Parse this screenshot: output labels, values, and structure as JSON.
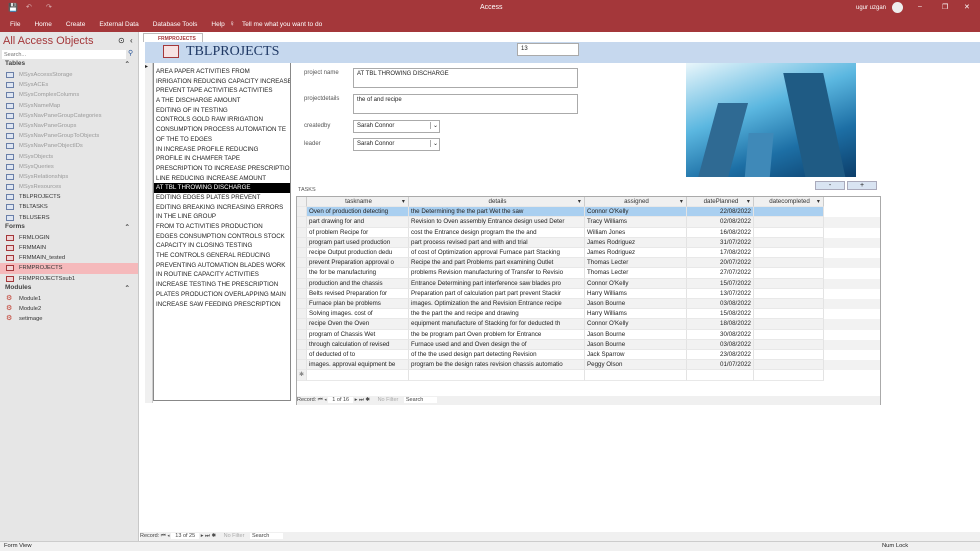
{
  "app": {
    "title": "Access",
    "user": "ugur uzgan",
    "menu": [
      "File",
      "Home",
      "Create",
      "External Data",
      "Database Tools",
      "Help"
    ],
    "tell_me": "Tell me what you want to do"
  },
  "nav": {
    "title": "All Access Objects",
    "search_placeholder": "Search...",
    "sections": [
      {
        "label": "Tables",
        "kind": "t",
        "items": [
          {
            "label": "MSysAccessStorage",
            "sys": true
          },
          {
            "label": "MSysACEs",
            "sys": true
          },
          {
            "label": "MSysComplexColumns",
            "sys": true
          },
          {
            "label": "MSysNameMap",
            "sys": true
          },
          {
            "label": "MSysNavPaneGroupCategories",
            "sys": true
          },
          {
            "label": "MSysNavPaneGroups",
            "sys": true
          },
          {
            "label": "MSysNavPaneGroupToObjects",
            "sys": true
          },
          {
            "label": "MSysNavPaneObjectIDs",
            "sys": true
          },
          {
            "label": "MSysObjects",
            "sys": true
          },
          {
            "label": "MSysQueries",
            "sys": true
          },
          {
            "label": "MSysRelationships",
            "sys": true
          },
          {
            "label": "MSysResources",
            "sys": true
          },
          {
            "label": "TBLPROJECTS"
          },
          {
            "label": "TBLTASKS"
          },
          {
            "label": "TBLUSERS"
          }
        ]
      },
      {
        "label": "Forms",
        "kind": "f",
        "items": [
          {
            "label": "FRMLOGIN"
          },
          {
            "label": "FRMMAIN"
          },
          {
            "label": "FRMMAIN_tested"
          },
          {
            "label": "FRMPROJECTS",
            "selected": true
          },
          {
            "label": "FRMPROJECTSsub1"
          }
        ]
      },
      {
        "label": "Modules",
        "kind": "m",
        "items": [
          {
            "label": "Module1"
          },
          {
            "label": "Module2"
          },
          {
            "label": "setimage"
          }
        ]
      }
    ]
  },
  "form": {
    "tab": "FRMPROJECTS",
    "title": "TBLPROJECTS",
    "id_value": "13",
    "projects": [
      "AREA PAPER ACTIVITIES FROM",
      "IRRIGATION REDUCING CAPACITY INCREASE",
      "PREVENT TAPE ACTIVITIES ACTIVITIES",
      "A THE DISCHARGE AMOUNT",
      "EDITING OF IN TESTING",
      "CONTROLS GOLD RAW IRRIGATION",
      "CONSUMPTION PROCESS AUTOMATION TE",
      "OF THE TO EDGES",
      "IN INCREASE PROFILE REDUCING",
      "PROFILE IN CHAMFER TAPE",
      "PRESCRIPTION TO INCREASE PRESCRIPTION",
      "LINE REDUCING INCREASE AMOUNT",
      "AT TBL THROWING DISCHARGE",
      "EDITING EDGES PLATES PREVENT",
      "EDITING BREAKING INCREASING ERRORS",
      "IN THE LINE GROUP",
      "FROM TO ACTIVITIES PRODUCTION",
      "EDGES CONSUMPTION CONTROLS STOCK",
      "CAPACITY IN CLOSING TESTING",
      "THE CONTROLS GENERAL REDUCING",
      "PREVENTING AUTOMATION BLADES WORK",
      "IN ROUTINE CAPACITY ACTIVITIES",
      "INCREASE TESTING THE PRESCRIPTION",
      "PLATES PRODUCTION OVERLAPPING MAIN",
      "INCREASE SAW FEEDING PRESCRIPTION"
    ],
    "selected_project_index": 12,
    "fields": {
      "project_name_label": "project name",
      "project_name": "AT TBL THROWING DISCHARGE",
      "projectdetails_label": "projectdetails",
      "projectdetails": "the of and recipe",
      "createdby_label": "createdby",
      "createdby": "Sarah Connor",
      "leader_label": "leader",
      "leader": "Sarah Connor"
    },
    "tasks_label": "TASKS",
    "minus": "-",
    "plus": "+",
    "record_nav": {
      "label": "Record:",
      "position": "13 of 25",
      "filter": "No Filter",
      "search": "Search"
    }
  },
  "tasks": {
    "columns": [
      "taskname",
      "details",
      "assigned",
      "datePlanned",
      "datecompleted"
    ],
    "rows": [
      [
        "Oven of production detecting",
        "the Determining the the part Wet the saw",
        "Connor O'Kelly",
        "22/08/2022",
        ""
      ],
      [
        "part drawing for and",
        "Revision to Oven assembly Entrance design used Deter",
        "Tracy Williams",
        "02/08/2022",
        ""
      ],
      [
        "of problem Recipe for",
        "cost the Entrance design program the the and",
        "William Jones",
        "16/08/2022",
        ""
      ],
      [
        "program part used production",
        "part process revised part and with and trial",
        "James Rodriguez",
        "31/07/2022",
        ""
      ],
      [
        "recipe Output production dedu",
        "of cost of Optimization approval Furnace part Stacking",
        "James Rodriguez",
        "17/08/2022",
        ""
      ],
      [
        "prevent Preparation approval o",
        "Recipe the and part Problems part examining Outlet",
        "Thomas Lecter",
        "20/07/2022",
        ""
      ],
      [
        "the for be manufacturing",
        "problems Revision manufacturing of Transfer to Revisio",
        "Thomas Lecter",
        "27/07/2022",
        ""
      ],
      [
        "production and the chassis",
        "Entrance Determining part interference saw blades pro",
        "Connor O'Kelly",
        "15/07/2022",
        ""
      ],
      [
        "Belts revised Preparation for",
        "Preparation part of calculation part part prevent Stackir",
        "Harry Williams",
        "13/07/2022",
        ""
      ],
      [
        "Furnace plan be problems",
        "images. Optimization the and Revision Entrance recipe",
        "Jason Bourne",
        "03/08/2022",
        ""
      ],
      [
        "Solving images. cost of",
        "the the part the and recipe and drawing",
        "Harry Williams",
        "15/08/2022",
        ""
      ],
      [
        "recipe Oven the Oven",
        "equipment manufacture of Stacking for for deducted th",
        "Connor O'Kelly",
        "18/08/2022",
        ""
      ],
      [
        "program of Chassis Wet",
        "the be program part Oven problem for Entrance",
        "Jason Bourne",
        "30/08/2022",
        ""
      ],
      [
        "through calculation of revised",
        "Furnace used and and Oven design the of",
        "Jason Bourne",
        "03/08/2022",
        ""
      ],
      [
        "of deducted of to",
        "of the the used design part detecting Revision",
        "Jack Sparrow",
        "23/08/2022",
        ""
      ],
      [
        "images. approval equipment be",
        "program be the design rates revision chassis automatio",
        "Peggy Olson",
        "01/07/2022",
        ""
      ]
    ],
    "record_nav": {
      "label": "Record:",
      "position": "1 of 16",
      "filter": "No Filter",
      "search": "Search"
    }
  },
  "status": {
    "left": "Form View",
    "right": "Num Lock"
  },
  "colors": {
    "accent": "#a4373a",
    "header_band": "#c6d8ee",
    "selected_row": "#a9cff0"
  }
}
